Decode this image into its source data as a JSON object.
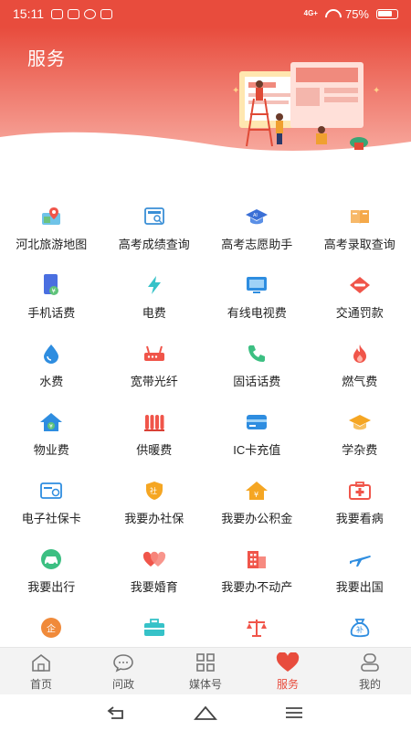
{
  "status_bar": {
    "time": "15:11",
    "network": "4G+",
    "battery": "75%"
  },
  "header": {
    "title": "服务"
  },
  "services": [
    [
      {
        "label": "河北旅游地图",
        "icon": "map-icon"
      },
      {
        "label": "高考成绩查询",
        "icon": "score-report-icon"
      },
      {
        "label": "高考志愿助手",
        "icon": "graduation-cap-icon"
      },
      {
        "label": "高考录取查询",
        "icon": "book-icon"
      }
    ],
    [
      {
        "label": "手机话费",
        "icon": "phone-bill-icon"
      },
      {
        "label": "电费",
        "icon": "lightning-icon"
      },
      {
        "label": "有线电视费",
        "icon": "tv-icon"
      },
      {
        "label": "交通罚款",
        "icon": "traffic-ticket-icon"
      }
    ],
    [
      {
        "label": "水费",
        "icon": "water-drop-icon"
      },
      {
        "label": "宽带光纤",
        "icon": "router-icon"
      },
      {
        "label": "固话话费",
        "icon": "telephone-icon"
      },
      {
        "label": "燃气费",
        "icon": "flame-icon"
      }
    ],
    [
      {
        "label": "物业费",
        "icon": "house-icon"
      },
      {
        "label": "供暖费",
        "icon": "radiator-icon"
      },
      {
        "label": "IC卡充值",
        "icon": "card-icon"
      },
      {
        "label": "学杂费",
        "icon": "mortarboard-icon"
      }
    ],
    [
      {
        "label": "电子社保卡",
        "icon": "social-security-card-icon"
      },
      {
        "label": "我要办社保",
        "icon": "shield-icon"
      },
      {
        "label": "我要办公积金",
        "icon": "housing-fund-icon"
      },
      {
        "label": "我要看病",
        "icon": "medical-kit-icon"
      }
    ],
    [
      {
        "label": "我要出行",
        "icon": "car-icon"
      },
      {
        "label": "我要婚育",
        "icon": "hearts-icon"
      },
      {
        "label": "我要办不动产",
        "icon": "building-icon"
      },
      {
        "label": "我要出国",
        "icon": "airplane-icon"
      }
    ],
    [
      {
        "label": "",
        "icon": "enterprise-icon"
      },
      {
        "label": "",
        "icon": "briefcase-icon"
      },
      {
        "label": "",
        "icon": "scales-icon"
      },
      {
        "label": "",
        "icon": "subsidy-bag-icon"
      }
    ]
  ],
  "bottom_nav": [
    {
      "label": "首页",
      "icon": "home-icon",
      "active": false
    },
    {
      "label": "问政",
      "icon": "chat-icon",
      "active": false
    },
    {
      "label": "媒体号",
      "icon": "grid-icon",
      "active": false
    },
    {
      "label": "服务",
      "icon": "heart-icon",
      "active": true
    },
    {
      "label": "我的",
      "icon": "user-icon",
      "active": false
    }
  ],
  "colors": {
    "brand_red": "#e84c3d"
  }
}
